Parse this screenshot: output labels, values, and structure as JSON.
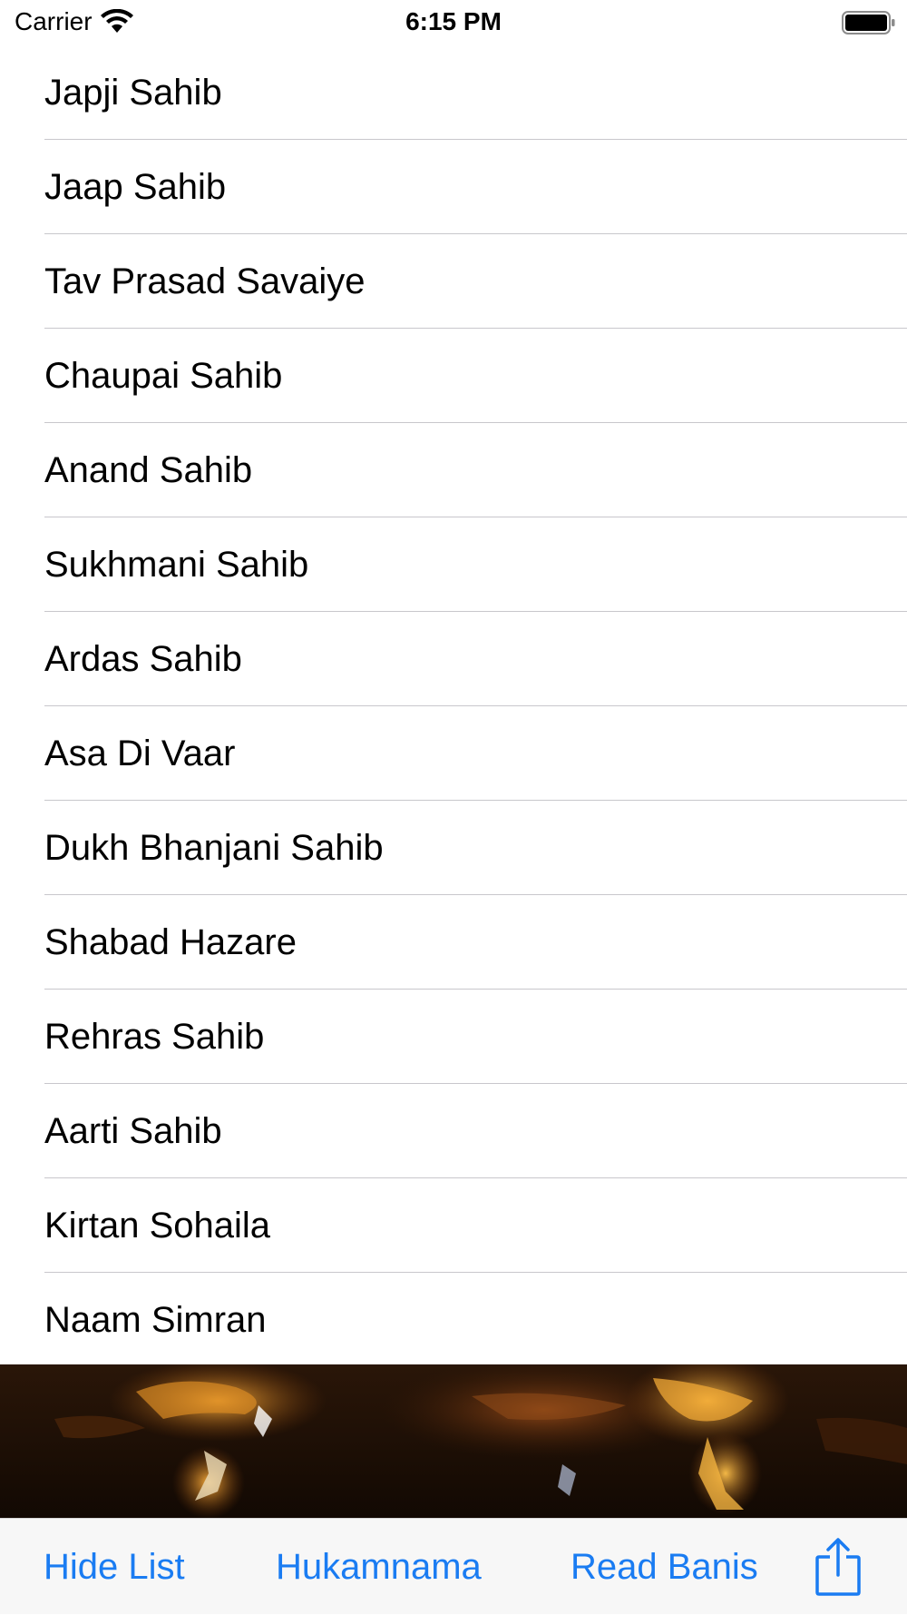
{
  "status_bar": {
    "carrier": "Carrier",
    "time": "6:15 PM",
    "icons": [
      "wifi-icon",
      "battery-icon"
    ]
  },
  "banis": [
    "Japji Sahib",
    "Jaap Sahib",
    "Tav Prasad Savaiye",
    "Chaupai Sahib",
    "Anand Sahib",
    "Sukhmani Sahib",
    "Ardas Sahib",
    "Asa Di Vaar",
    "Dukh Bhanjani Sahib",
    "Shabad Hazare",
    "Rehras Sahib",
    "Aarti Sahib",
    "Kirtan Sohaila",
    "Naam Simran"
  ],
  "toolbar": {
    "hide_list_label": "Hide List",
    "hukamnama_label": "Hukamnama",
    "read_banis_label": "Read Banis",
    "share_icon": "share-icon"
  },
  "colors": {
    "accent": "#1a7cf2",
    "separator": "#c8c7cc",
    "toolbar_bg": "#f7f7f7"
  }
}
